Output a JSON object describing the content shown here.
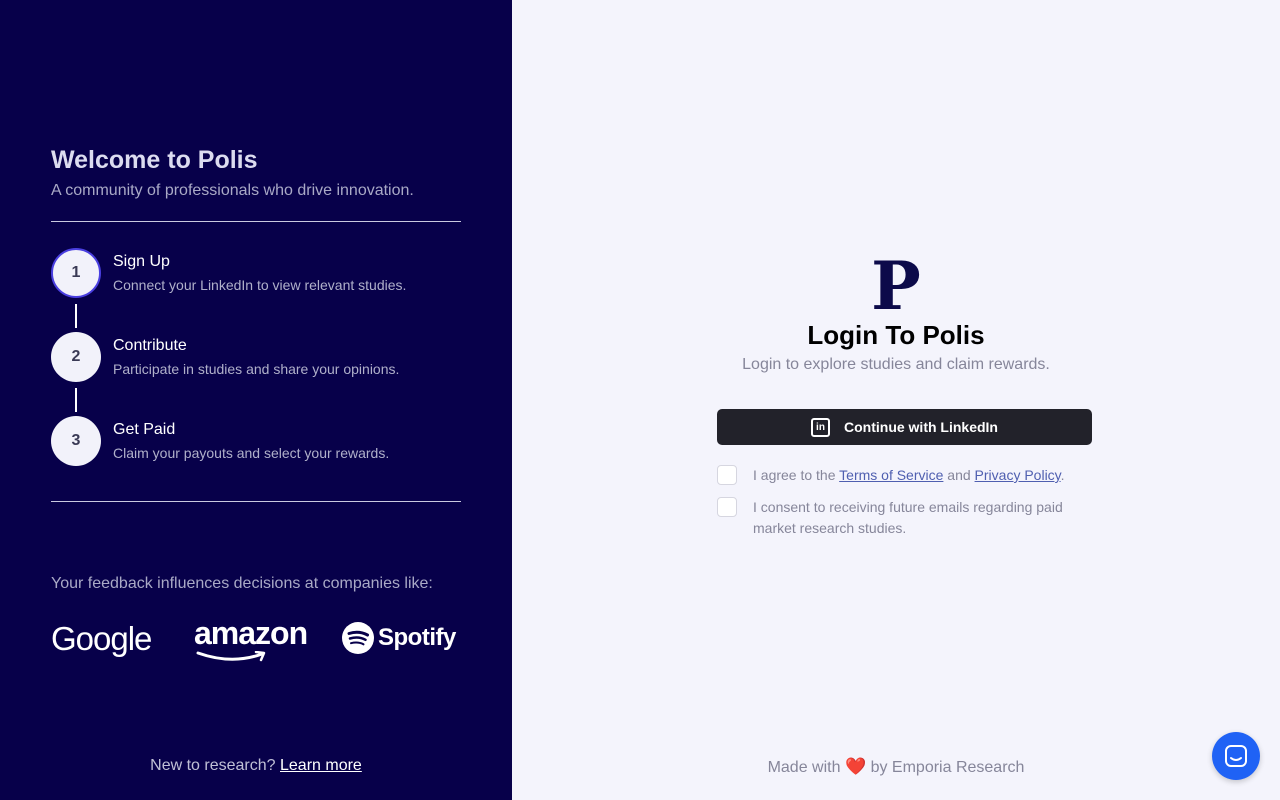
{
  "left": {
    "title": "Welcome to Polis",
    "subtitle": "A community of professionals who drive innovation.",
    "steps": [
      {
        "number": "1",
        "title": "Sign Up",
        "description": "Connect your LinkedIn to view relevant studies."
      },
      {
        "number": "2",
        "title": "Contribute",
        "description": "Participate in studies and share your opinions."
      },
      {
        "number": "3",
        "title": "Get Paid",
        "description": "Claim your payouts and select your rewards."
      }
    ],
    "feedback": "Your feedback influences decisions at companies like:",
    "logos": {
      "google": "Google",
      "amazon": "amazon",
      "spotify": "Spotify"
    },
    "footer": {
      "text": "New to research?",
      "link": "Learn more"
    }
  },
  "right": {
    "brand_letter": "P",
    "title": "Login To Polis",
    "subtitle": "Login to explore studies and claim rewards.",
    "linkedin_button": "Continue with LinkedIn",
    "linkedin_icon_text": "in",
    "agree": {
      "prefix": "I agree to the",
      "terms": "Terms of Service",
      "and": "and",
      "privacy": "Privacy Policy",
      "suffix": "."
    },
    "consent": "I consent to receiving future emails regarding paid market research studies.",
    "footer": {
      "prefix": "Made with",
      "heart": "❤️",
      "suffix": "by Emporia Research"
    }
  },
  "colors": {
    "left_bg": "#07004a",
    "right_bg": "#f4f4fc",
    "button_bg": "#22222a",
    "chat_bg": "#1f62f5"
  },
  "icons": {
    "linkedin": "linkedin-icon",
    "chat": "chat-icon",
    "spotify": "spotify-icon"
  }
}
